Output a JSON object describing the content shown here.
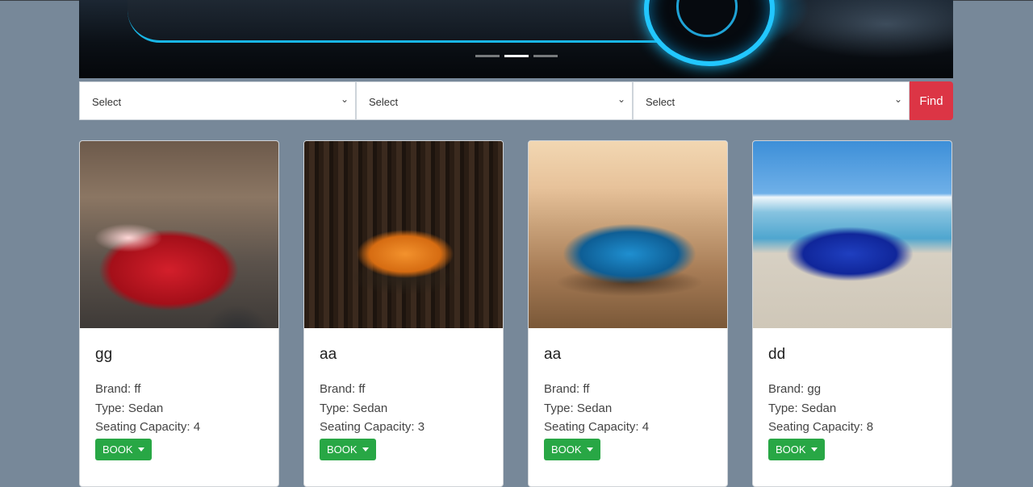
{
  "theme": {
    "page_bg": "#778899",
    "find_color": "#dc3545",
    "book_color": "#28a745"
  },
  "carousel": {
    "slides": 3,
    "active_index": 1
  },
  "filters": {
    "brand_select": "Select",
    "type_select": "Select",
    "capacity_select": "Select",
    "find_label": "Find"
  },
  "cars": [
    {
      "name": "gg",
      "brand_text": "Brand: ff",
      "type_text": "Type: Sedan",
      "capacity_text": "Seating Capacity: 4",
      "book_label": "BOOK"
    },
    {
      "name": "aa",
      "brand_text": "Brand: ff",
      "type_text": "Type: Sedan",
      "capacity_text": "Seating Capacity: 3",
      "book_label": "BOOK"
    },
    {
      "name": "aa",
      "brand_text": "Brand: ff",
      "type_text": "Type: Sedan",
      "capacity_text": "Seating Capacity: 4",
      "book_label": "BOOK"
    },
    {
      "name": "dd",
      "brand_text": "Brand: gg",
      "type_text": "Type: Sedan",
      "capacity_text": "Seating Capacity: 8",
      "book_label": "BOOK"
    }
  ]
}
